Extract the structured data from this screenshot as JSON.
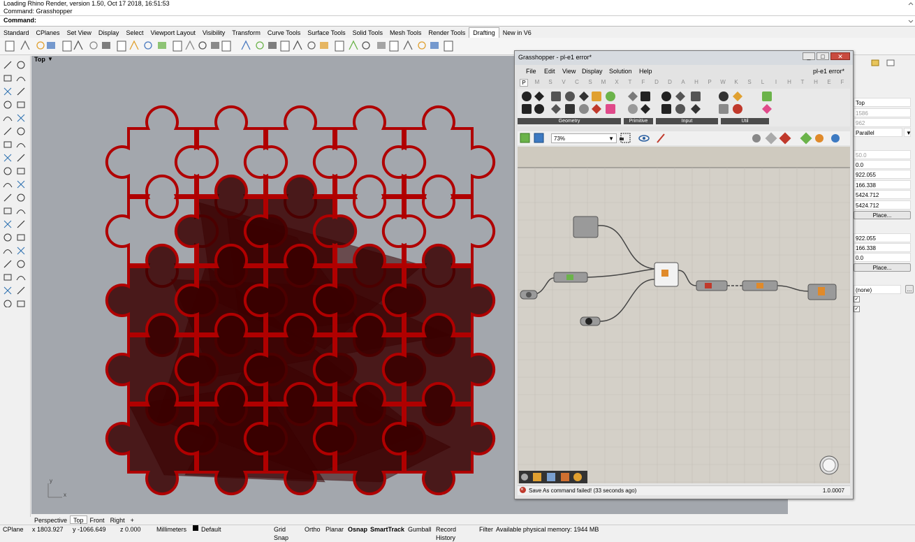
{
  "command_history": {
    "line1": "Loading Rhino Render, version 1.50, Oct 17 2018, 16:51:53",
    "line2": "Command: Grasshopper",
    "prompt": "Command:"
  },
  "tabs": [
    "Standard",
    "CPlanes",
    "Set View",
    "Display",
    "Select",
    "Viewport Layout",
    "Visibility",
    "Transform",
    "Curve Tools",
    "Surface Tools",
    "Solid Tools",
    "Mesh Tools",
    "Render Tools",
    "Drafting",
    "New in V6"
  ],
  "active_tab": "Drafting",
  "viewport": {
    "title": "Top",
    "axis_y": "y",
    "axis_x": "x"
  },
  "viewport_tabs": [
    "Perspective",
    "Top",
    "Front",
    "Right"
  ],
  "viewport_tab_add": "+",
  "status_bar": {
    "cplane": "CPlane",
    "x": "x 1803.927",
    "y": "y -1066.649",
    "z": "z 0.000",
    "units": "Millimeters",
    "layer": "Default",
    "items": [
      "Grid Snap",
      "Ortho",
      "Planar",
      "Osnap",
      "SmartTrack",
      "Gumball",
      "Record History",
      "Filter"
    ],
    "memory": "Available physical memory: 1944 MB"
  },
  "right_panel": {
    "values": [
      "Top",
      "1586",
      "962",
      "Parallel",
      "50.0",
      "0.0",
      "922.055",
      "166.338",
      "5424.712",
      "5424.712"
    ],
    "place_button": "Place...",
    "values2": [
      "922.055",
      "166.338",
      "0.0"
    ],
    "place_button2": "Place...",
    "none_value": "(none)",
    "more_button": "...",
    "check_mark": "✓"
  },
  "grasshopper": {
    "title": "Grasshopper - pl-e1 error*",
    "doc_name": "pl-e1 error*",
    "menu": [
      "File",
      "Edit",
      "View",
      "Display",
      "Solution",
      "Help"
    ],
    "categories": [
      "P",
      "M",
      "S",
      "V",
      "C",
      "S",
      "M",
      "X",
      "T",
      "F",
      "D",
      "D",
      "A",
      "H",
      "P",
      "W",
      "K",
      "S",
      "L",
      "I",
      "H",
      "T",
      "H",
      "E",
      "F"
    ],
    "ribbon_panels": [
      "Geometry",
      "Primitive",
      "Input",
      "Util"
    ],
    "zoom": "73%",
    "status_message": "Save As command failed! (33 seconds ago)",
    "version": "1.0.0007",
    "win_buttons": {
      "minimize": "_",
      "maximize": "□",
      "close": "✕"
    }
  },
  "colors": {
    "viewport_bg": "#a3a7ad",
    "shape_red": "#b00000",
    "shape_fill": "#3a0000",
    "gh_canvas": "#d4d0c8",
    "error_red": "#c0392b"
  }
}
